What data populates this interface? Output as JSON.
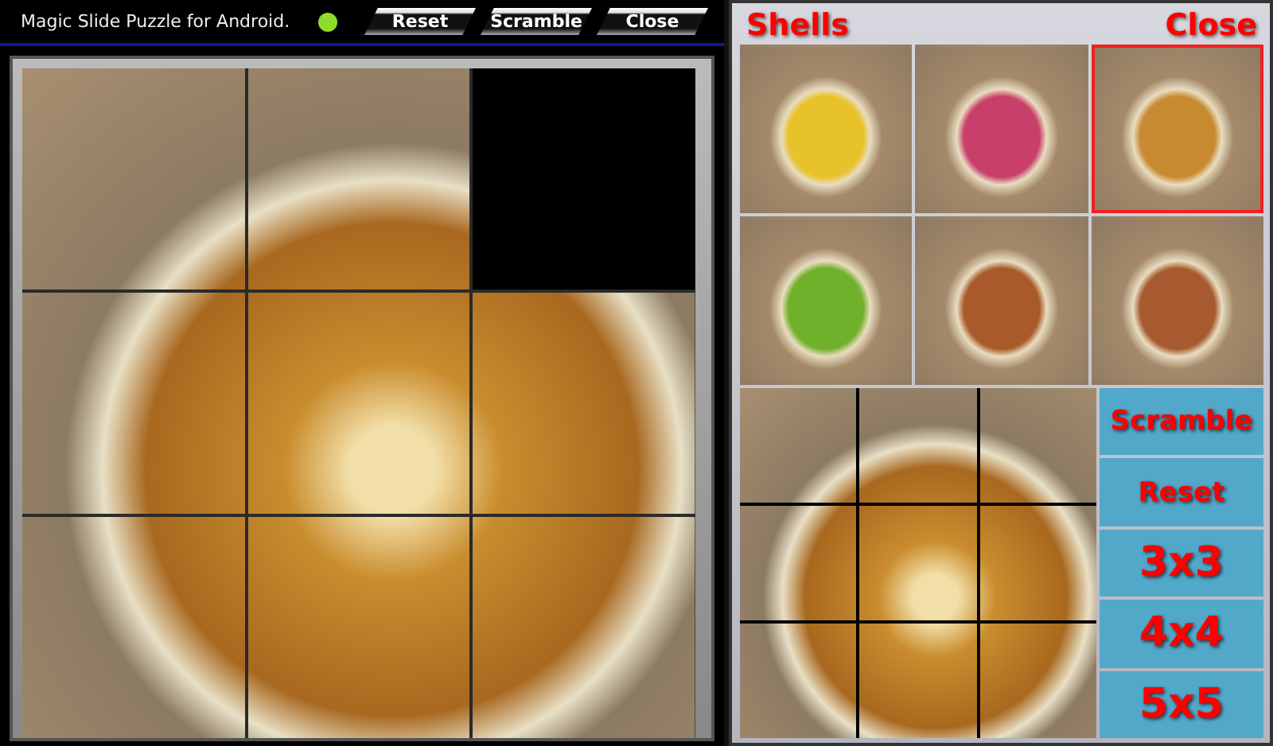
{
  "title_bar": {
    "title": "Magic Slide Puzzle for Android.",
    "buttons": [
      "Reset",
      "Scramble",
      "Close"
    ]
  },
  "board": {
    "tiles": [
      {
        "empty": false
      },
      {
        "empty": false
      },
      {
        "empty": true
      },
      {
        "empty": false
      },
      {
        "empty": false
      },
      {
        "empty": false
      },
      {
        "empty": false
      },
      {
        "empty": false
      },
      {
        "empty": false
      }
    ]
  },
  "gallery": {
    "title": "Shells",
    "close": "Close",
    "thumbnails": [
      {
        "selected": false
      },
      {
        "selected": false
      },
      {
        "selected": true
      },
      {
        "selected": false
      },
      {
        "selected": false
      },
      {
        "selected": false
      }
    ]
  },
  "controls": [
    "Scramble",
    "Reset",
    "3x3",
    "4x4",
    "5x5"
  ]
}
